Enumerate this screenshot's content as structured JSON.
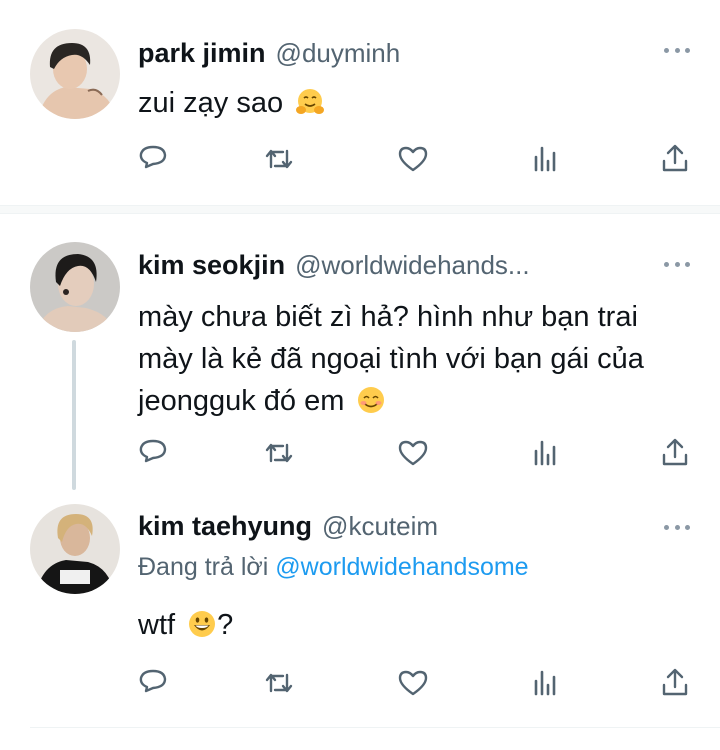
{
  "tweets": [
    {
      "name": "park jimin",
      "handle": "@duyminh",
      "text": "zui zạy sao",
      "emoji": "hugging-face",
      "colors": {
        "avatar_bg": "#e9e4de",
        "skin": "#e8c8b0",
        "hair": "#2a2623"
      }
    },
    {
      "name": "kim seokjin",
      "handle": "@worldwidehands...",
      "text_lines": [
        "mày chưa biết zì hả? hình như bạn trai",
        "mày là kẻ đã ngoại tình với bạn gái của",
        "jeongguk đó em"
      ],
      "emoji": "smiling-face",
      "colors": {
        "avatar_bg": "#c9c7c4",
        "skin": "#e4cdbd",
        "hair": "#1d1b1a"
      }
    },
    {
      "name": "kim taehyung",
      "handle": "@kcuteim",
      "reply_prefix": "Đang trả lời",
      "reply_mention": "@worldwidehandsome",
      "text": "wtf",
      "text_suffix": "?",
      "emoji": "grinning-face",
      "colors": {
        "avatar_bg": "#e7e3de",
        "skin": "#d9b79b",
        "hair": "#d4b27a",
        "shirt": "#151515"
      }
    }
  ],
  "actions": [
    "reply-icon",
    "retweet-icon",
    "like-icon",
    "stats-icon",
    "share-icon"
  ],
  "colors": {
    "text": "#0f1419",
    "secondary": "#536471",
    "link": "#1d9bf0",
    "icon": "#536471",
    "thread_line": "#cfd9de"
  }
}
